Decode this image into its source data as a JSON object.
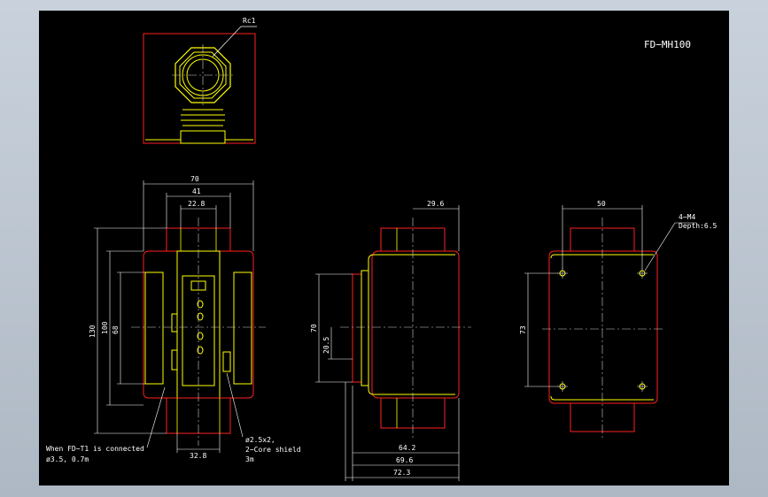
{
  "drawing": {
    "title": "FD−MH100",
    "colors": {
      "outline": "#ff2020",
      "part": "#ffff00",
      "dim": "#ffffff",
      "center": "#cfcfcf"
    },
    "labels": {
      "rc": "Rc1",
      "dim_70_top": "70",
      "dim_41": "41",
      "dim_22_8": "22.8",
      "dim_130": "130",
      "dim_100": "100",
      "dim_68": "68",
      "dim_32_8": "32.8",
      "note_left_1": "When FD−T1 is connected",
      "note_left_2": "ø3.5, 0.7m",
      "note_right_1": "ø2.5x2,",
      "note_right_2": "2−Core shield",
      "note_right_3": "3m",
      "dim_29_6": "29.6",
      "dim_70_side": "70",
      "dim_20_5": "20.5",
      "dim_64_2": "64.2",
      "dim_69_6": "69.6",
      "dim_72_3": "72.3",
      "dim_50": "50",
      "dim_73": "73",
      "note_m4_1": "4−M4",
      "note_m4_2": "Depth:6.5"
    }
  }
}
